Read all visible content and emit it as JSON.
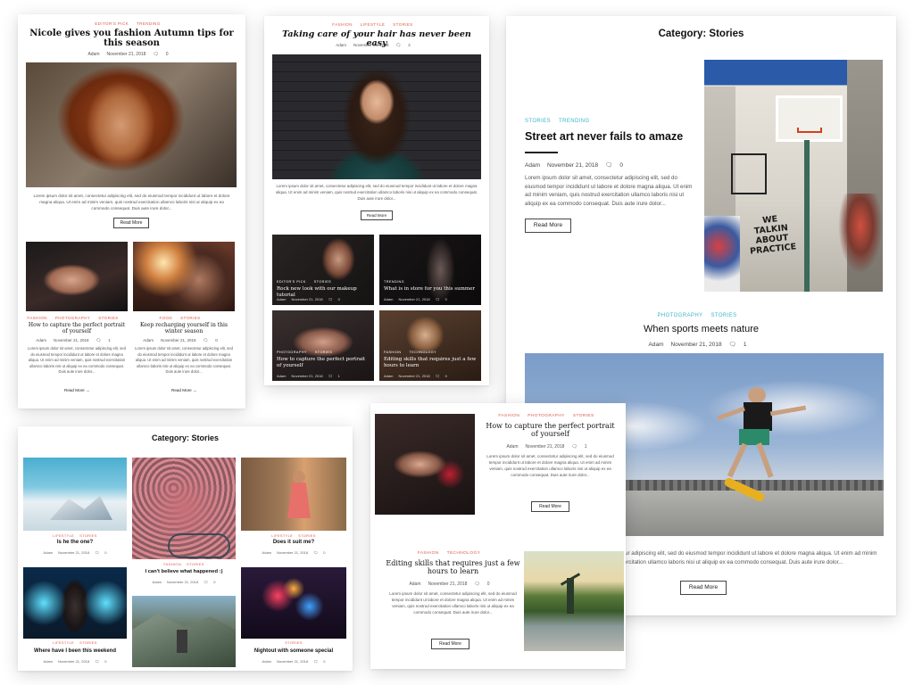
{
  "card1": {
    "top_cats": [
      "Editor's Pick",
      "Trending"
    ],
    "title": "Nicole gives you fashion Autumn tips for this season",
    "meta": {
      "author": "Adam",
      "date": "November 21, 2018",
      "comments": "0"
    },
    "excerpt": "Lorem ipsum dolor sit amet, consectetur adipiscing elit, sed do eiusmod tempor incididunt ut labore et dolore magna aliqua. Ut enim ad minim veniam, quis nostrud exercitation ullamco laboris nisi ut aliquip ex ea commodo consequat. Duis aute irure dolor...",
    "read_more": "Read More",
    "post_left": {
      "cats": [
        "Fashion",
        "Photography",
        "Stories"
      ],
      "title": "How to capture the perfect portrait of yourself",
      "meta": {
        "author": "Adam",
        "date": "November 21, 2018",
        "comments": "1"
      },
      "excerpt": "Lorem ipsum dolor sit amet, consectetur adipiscing elit, sed do eiusmod tempor incididunt ut labore et dolore magna aliqua. Ut enim ad minim veniam, quis nostrud exercitation ullamco laboris nisi ut aliquip ex ea commodo consequat. Duis aute irure dolor...",
      "read_more": "Read More"
    },
    "post_right": {
      "cats": [
        "Food",
        "Stories"
      ],
      "title": "Keep recharging yourself in this winter season",
      "meta": {
        "author": "Adam",
        "date": "November 21, 2018",
        "comments": "0"
      },
      "excerpt": "Lorem ipsum dolor sit amet, consectetur adipiscing elit, sed do eiusmod tempor incididunt ut labore et dolore magna aliqua. Ut enim ad minim veniam, quis nostrud exercitation ullamco laboris nisi ut aliquip ex ea commodo consequat. Duis aute irure dolor...",
      "read_more": "Read More"
    }
  },
  "card2": {
    "top_cats": [
      "Fashion",
      "Lifestyle",
      "Stories"
    ],
    "title": "Taking care of your hair has never been easy",
    "meta": {
      "author": "Adam",
      "date": "November 21, 2018",
      "comments": "2"
    },
    "excerpt": "Lorem ipsum dolor sit amet, consectetur adipiscing elit, sed do eiusmod tempor incididunt ut labore et dolore magna aliqua. Ut enim ad minim veniam, quis nostrud exercitation ullamco laboris nisi ut aliquip ex ea commodo consequat. Duis aute irure dolor...",
    "read_more": "Read More",
    "tiles": [
      {
        "cats": [
          "Editor's Pick",
          "Stories"
        ],
        "title": "Rock new look with our makeup tutorial",
        "author": "Adam",
        "date": "November 21, 2018",
        "comments": "0"
      },
      {
        "cats": [
          "Trending"
        ],
        "title": "What is in store for you this summer",
        "author": "Adam",
        "date": "November 21, 2018",
        "comments": "0"
      },
      {
        "cats": [
          "Photography",
          "Stories"
        ],
        "title": "How to capture the perfect portrait of yourself",
        "author": "Adam",
        "date": "November 21, 2018",
        "comments": "1"
      },
      {
        "cats": [
          "Fashion",
          "Technology"
        ],
        "title": "Editing skills that requires just a few hours to learn",
        "author": "Adam",
        "date": "November 21, 2018",
        "comments": "0"
      }
    ]
  },
  "card3": {
    "heading": "Category: Stories",
    "featured": {
      "cats": [
        "Stories",
        "Trending"
      ],
      "title": "Street art never fails to amaze",
      "meta": {
        "author": "Adam",
        "date": "November 21, 2018",
        "comments": "0"
      },
      "excerpt": "Lorem ipsum dolor sit amet, consectetur adipiscing elit, sed do eiusmod tempor incididunt ut labore et dolore magna aliqua. Ut enim ad minim veniam, quis nostrud exercitation ullamco laboris nisi ut aliquip ex ea commodo consequat. Duis aute irure dolor...",
      "read_more": "Read More",
      "image_text": "WE TALKIN ABOUT PRACTICE"
    },
    "second": {
      "cats": [
        "Photography",
        "Stories"
      ],
      "title": "When sports meets nature",
      "meta": {
        "author": "Adam",
        "date": "November 21, 2018",
        "comments": "1"
      },
      "excerpt": "Lorem ipsum dolor sit amet, consectetur adipiscing elit, sed do eiusmod tempor incididunt ut labore et dolore magna aliqua. Ut enim ad minim veniam, quis nostrud exercitation ullamco laboris nisi ut aliquip ex ea commodo consequat. Duis aute irure dolor...",
      "read_more": "Read More"
    }
  },
  "card4": {
    "heading": "Category: Stories",
    "tiles": [
      {
        "cats": [
          "Lifestyle",
          "Stories"
        ],
        "title": "Is he the one?",
        "author": "Adam",
        "date": "November 21, 2018",
        "comments": "0"
      },
      {
        "cats": [
          "Fashion",
          "Stories"
        ],
        "title": "I can't believe what happened :)",
        "author": "Adam",
        "date": "November 21, 2018",
        "comments": "0"
      },
      {
        "cats": [
          "Lifestyle",
          "Stories"
        ],
        "title": "Does it suit me?",
        "author": "Adam",
        "date": "November 21, 2018",
        "comments": "0"
      },
      {
        "cats": [
          "Lifestyle",
          "Stories"
        ],
        "title": "Where have I been this weekend",
        "author": "Adam",
        "date": "November 21, 2018",
        "comments": "0"
      },
      {
        "cats": [
          "Stories"
        ],
        "title": "Nightout with someone special",
        "author": "Adam",
        "date": "November 21, 2018",
        "comments": "0"
      }
    ]
  },
  "card5": {
    "post1": {
      "cats": [
        "Fashion",
        "Photography",
        "Stories"
      ],
      "title": "How to capture the perfect portrait of yourself",
      "meta": {
        "author": "Adam",
        "date": "November 21, 2018",
        "comments": "1"
      },
      "excerpt": "Lorem ipsum dolor sit amet, consectetur adipiscing elit, sed do eiusmod tempor incididunt ut labore et dolore magna aliqua. Ut enim ad minim veniam, quis nostrud exercitation ullamco laboris nisi ut aliquip ex ea commodo consequat. Duis aute irure dolor...",
      "read_more": "Read More"
    },
    "post2": {
      "cats": [
        "Fashion",
        "Technology"
      ],
      "title": "Editing skills that requires just a few hours to learn",
      "meta": {
        "author": "Adam",
        "date": "November 21, 2018",
        "comments": "0"
      },
      "excerpt": "Lorem ipsum dolor sit amet, consectetur adipiscing elit, sed do eiusmod tempor incididunt ut labore et dolore magna aliqua. Ut enim ad minim veniam, quis nostrud exercitation ullamco laboris nisi ut aliquip ex ea commodo consequat. Duis aute irure dolor...",
      "read_more": "Read More"
    }
  },
  "icons": {
    "comment": "comment-icon",
    "arrow": "arrow-right-icon"
  },
  "colors": {
    "category_red": "#e0584a",
    "category_teal": "#3bb5c9",
    "text_dark": "#111111"
  }
}
